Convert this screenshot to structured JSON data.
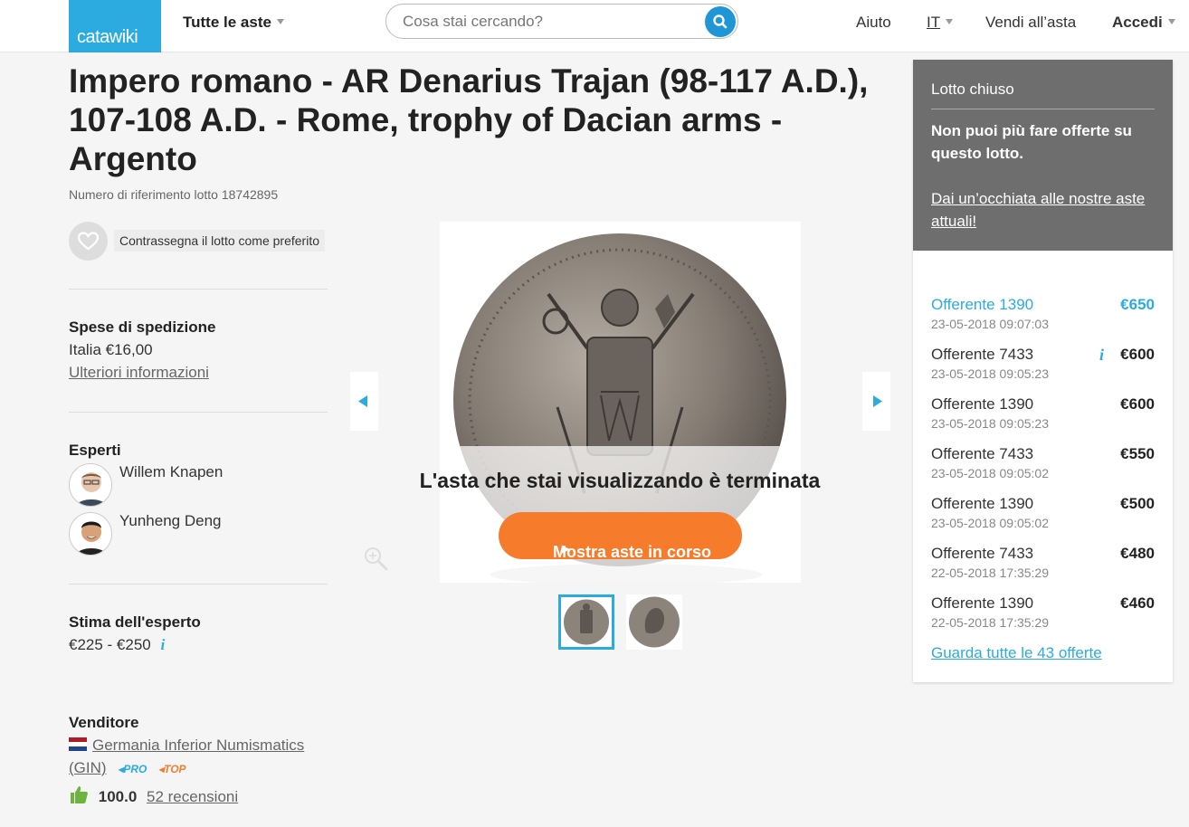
{
  "header": {
    "logo": "catawiki",
    "nav_auctions": "Tutte le aste",
    "search_placeholder": "Cosa stai cercando?",
    "help": "Aiuto",
    "language": "IT",
    "sell": "Vendi all’asta",
    "login": "Accedi"
  },
  "lot": {
    "title": "Impero romano - AR Denarius Trajan (98-117 A.D.), 107-108 A.D. - Rome, trophy of Dacian arms - Argento",
    "reference": "Numero di riferimento lotto 18742895",
    "favorite_label": "Contrassegna il lotto come preferito"
  },
  "shipping": {
    "heading": "Spese di spedizione",
    "value": "Italia €16,00",
    "more_info": "Ulteriori informazioni"
  },
  "experts": {
    "heading": "Esperti",
    "names": [
      "Willem Knapen",
      "Yunheng Deng"
    ]
  },
  "estimate": {
    "heading": "Stima dell'esperto",
    "value": "€225 - €250"
  },
  "seller": {
    "heading": "Venditore",
    "name_line1": "Germania Inferior Numismatics",
    "name_line2": "(GIN)",
    "badge_pro": "PRO",
    "badge_top": "TOP",
    "score": "100.0",
    "reviews": "52 recensioni"
  },
  "gallery": {
    "ended_message": "L'asta che stai visualizzando è terminata",
    "cta": "Mostra aste in corso"
  },
  "bidding": {
    "status": "Lotto chiuso",
    "message": "Non puoi più fare offerte su questo lotto.",
    "link": "Dai un’occhiata alle nostre aste attuali!",
    "bids": [
      {
        "bidder": "Offerente 1390",
        "date": "23-05-2018 09:07:03",
        "amount": "€650"
      },
      {
        "bidder": "Offerente 7433",
        "date": "23-05-2018 09:05:23",
        "amount": "€600"
      },
      {
        "bidder": "Offerente 1390",
        "date": "23-05-2018 09:05:23",
        "amount": "€600"
      },
      {
        "bidder": "Offerente 7433",
        "date": "23-05-2018 09:05:02",
        "amount": "€550"
      },
      {
        "bidder": "Offerente 1390",
        "date": "23-05-2018 09:05:02",
        "amount": "€500"
      },
      {
        "bidder": "Offerente 7433",
        "date": "22-05-2018 17:35:29",
        "amount": "€480"
      },
      {
        "bidder": "Offerente 1390",
        "date": "22-05-2018 17:35:29",
        "amount": "€460"
      }
    ],
    "all_bids": "Guarda tutte le 43 offerte"
  },
  "colors": {
    "brand": "#2cabe0",
    "cta": "#f67b2a",
    "panel_header": "#6e6e6e"
  }
}
